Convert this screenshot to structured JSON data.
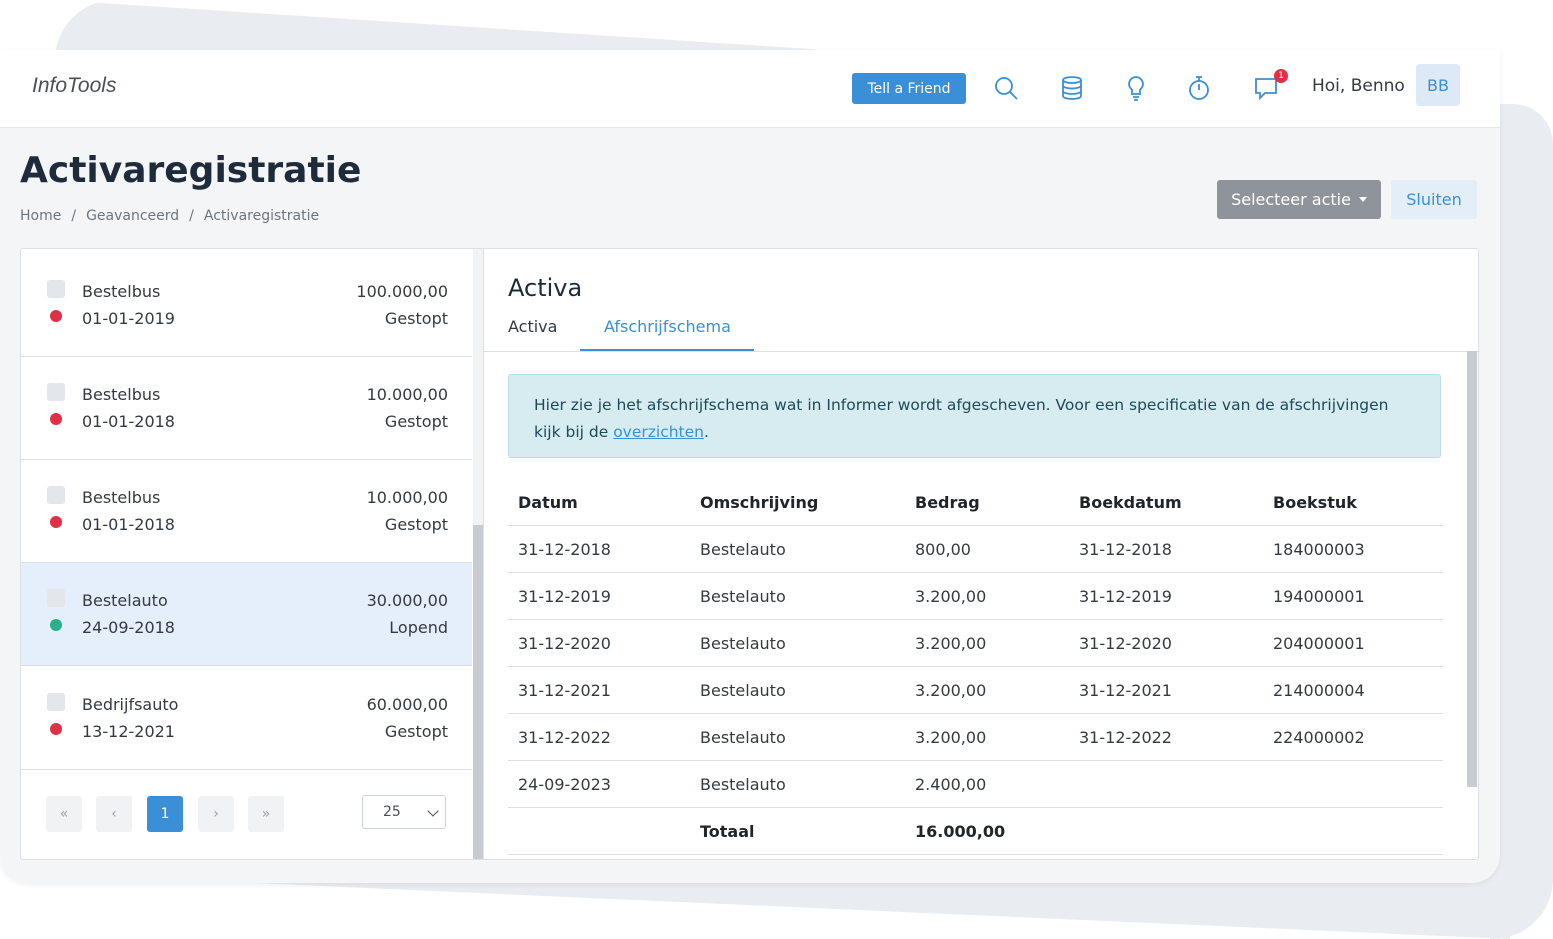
{
  "app": {
    "logo": "InfoTools"
  },
  "topbar": {
    "tell_friend": "Tell a Friend",
    "notification_count": "1",
    "greeting": "Hoi, Benno",
    "avatar_initials": "BB"
  },
  "page": {
    "title": "Activaregistratie",
    "breadcrumb": [
      "Home",
      "Geavanceerd",
      "Activaregistratie"
    ],
    "breadcrumb_sep": "/",
    "select_action": "Selecteer actie",
    "close": "Sluiten"
  },
  "list": {
    "items": [
      {
        "name": "Bestelbus",
        "date": "01-01-2019",
        "amount": "100.000,00",
        "status": "Gestopt",
        "status_color": "#e03045"
      },
      {
        "name": "Bestelbus",
        "date": "01-01-2018",
        "amount": "10.000,00",
        "status": "Gestopt",
        "status_color": "#e03045"
      },
      {
        "name": "Bestelbus",
        "date": "01-01-2018",
        "amount": "10.000,00",
        "status": "Gestopt",
        "status_color": "#e03045"
      },
      {
        "name": "Bestelauto",
        "date": "24-09-2018",
        "amount": "30.000,00",
        "status": "Lopend",
        "status_color": "#2bb08a"
      },
      {
        "name": "Bedrijfsauto",
        "date": "13-12-2021",
        "amount": "60.000,00",
        "status": "Gestopt",
        "status_color": "#e03045"
      }
    ],
    "pager": {
      "first": "«",
      "prev": "‹",
      "current": "1",
      "next": "›",
      "last": "»"
    },
    "page_size": "25"
  },
  "detail": {
    "title": "Activa",
    "tabs": [
      "Activa",
      "Afschrijfschema"
    ],
    "alert_text": "Hier zie je het afschrijfschema wat in Informer wordt afgescheven. Voor een specificatie van de afschrijvingen kijk bij de ",
    "alert_link": "overzichten",
    "alert_end": ".",
    "columns": [
      "Datum",
      "Omschrijving",
      "Bedrag",
      "Boekdatum",
      "Boekstuk"
    ],
    "rows": [
      [
        "31-12-2018",
        "Bestelauto",
        "800,00",
        "31-12-2018",
        "184000003"
      ],
      [
        "31-12-2019",
        "Bestelauto",
        "3.200,00",
        "31-12-2019",
        "194000001"
      ],
      [
        "31-12-2020",
        "Bestelauto",
        "3.200,00",
        "31-12-2020",
        "204000001"
      ],
      [
        "31-12-2021",
        "Bestelauto",
        "3.200,00",
        "31-12-2021",
        "214000004"
      ],
      [
        "31-12-2022",
        "Bestelauto",
        "3.200,00",
        "31-12-2022",
        "224000002"
      ],
      [
        "24-09-2023",
        "Bestelauto",
        "2.400,00",
        "",
        ""
      ]
    ],
    "total_label": "Totaal",
    "total_value": "16.000,00"
  },
  "colors": {
    "accent": "#3a8fd6",
    "danger": "#e03045",
    "success": "#2bb08a"
  }
}
